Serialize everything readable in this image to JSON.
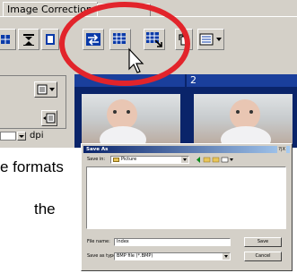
{
  "app": {
    "tab_active": "Image Correction",
    "tab_other": "",
    "thumb_left_number": "",
    "thumb_right_number": "2",
    "dpi_label": "dpi"
  },
  "toolbar": {
    "icons": [
      "grid-icon",
      "align-center-icon",
      "panel-icon",
      "swap-arrows-icon",
      "grid-pointer-icon",
      "grid-arrow-icon",
      "rotate-icon",
      "list-dropdown-icon"
    ]
  },
  "text": {
    "line1": "e formats",
    "line2": "the"
  },
  "dialog": {
    "title": "Save As",
    "help_close": "?|X",
    "save_in_label": "Save in:",
    "save_in_value": "Picture",
    "file_name_label": "File name:",
    "file_name_value": "Index",
    "save_as_type_label": "Save as type:",
    "save_as_type_value": "BMP file (*.BMP)",
    "save_button": "Save",
    "cancel_button": "Cancel"
  },
  "colors": {
    "annotation_ring": "#e2242b",
    "titlebar": "#0a246a",
    "thumb_bg": "#0a246a",
    "face": "#d4d0c8"
  }
}
